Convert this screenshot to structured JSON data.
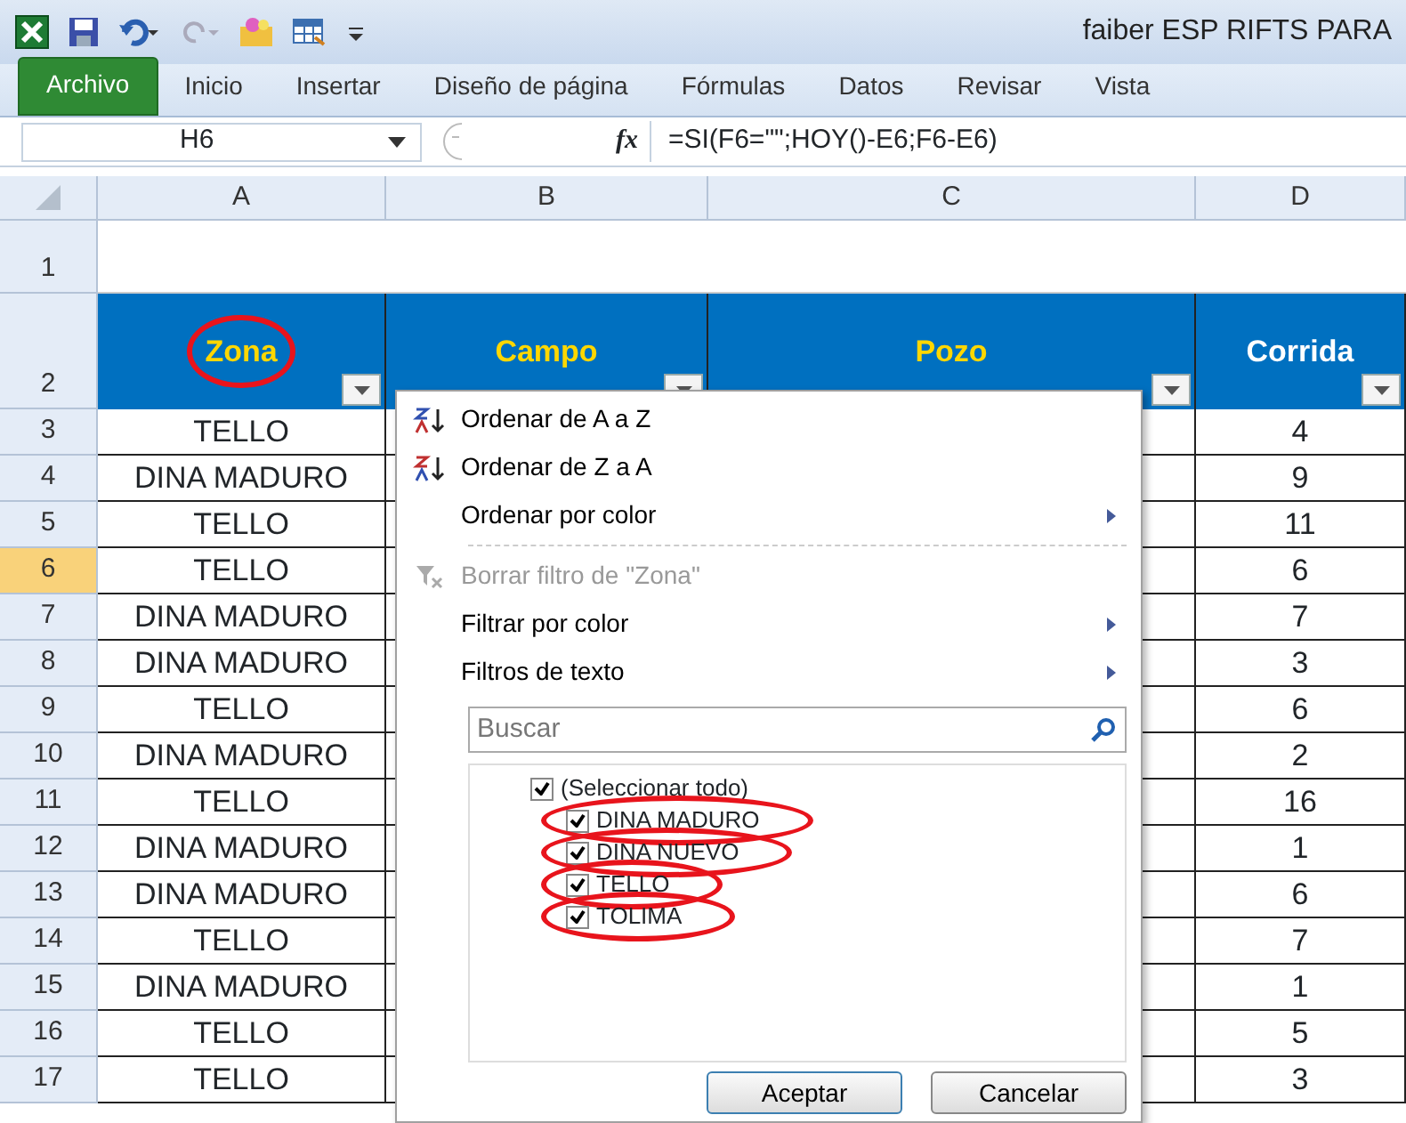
{
  "window": {
    "title": "faiber ESP RIFTS  PARA"
  },
  "ribbon_tabs": [
    {
      "label": "Archivo",
      "selected": true
    },
    {
      "label": "Inicio",
      "selected": false
    },
    {
      "label": "Insertar",
      "selected": false
    },
    {
      "label": "Diseño de página",
      "selected": false
    },
    {
      "label": "Fórmulas",
      "selected": false
    },
    {
      "label": "Datos",
      "selected": false
    },
    {
      "label": "Revisar",
      "selected": false
    },
    {
      "label": "Vista",
      "selected": false
    }
  ],
  "formula_bar": {
    "name_box": "H6",
    "function_button": "fx",
    "formula": "=SI(F6=\"\";HOY()-E6;F6-E6)"
  },
  "columns": [
    {
      "letter": "A",
      "header": "Zona",
      "color": "#ffd700",
      "circled": true
    },
    {
      "letter": "B",
      "header": "Campo",
      "color": "#ffd700",
      "circled": false
    },
    {
      "letter": "C",
      "header": "Pozo",
      "color": "#ffd700",
      "circled": false
    },
    {
      "letter": "D",
      "header": "Corrida",
      "color": "#ffffff",
      "circled": false
    }
  ],
  "header_row_numbers": [
    "1",
    "2"
  ],
  "rows": [
    {
      "number": "3",
      "zona": "TELLO",
      "corrida": "4",
      "selected": false
    },
    {
      "number": "4",
      "zona": "DINA MADURO",
      "corrida": "9",
      "selected": false
    },
    {
      "number": "5",
      "zona": "TELLO",
      "corrida": "11",
      "selected": false
    },
    {
      "number": "6",
      "zona": "TELLO",
      "corrida": "6",
      "selected": true
    },
    {
      "number": "7",
      "zona": "DINA MADURO",
      "corrida": "7",
      "selected": false
    },
    {
      "number": "8",
      "zona": "DINA MADURO",
      "corrida": "3",
      "selected": false
    },
    {
      "number": "9",
      "zona": "TELLO",
      "corrida": "6",
      "selected": false
    },
    {
      "number": "10",
      "zona": "DINA MADURO",
      "corrida": "2",
      "selected": false
    },
    {
      "number": "11",
      "zona": "TELLO",
      "corrida": "16",
      "selected": false
    },
    {
      "number": "12",
      "zona": "DINA MADURO",
      "corrida": "1",
      "selected": false
    },
    {
      "number": "13",
      "zona": "DINA MADURO",
      "corrida": "6",
      "selected": false
    },
    {
      "number": "14",
      "zona": "TELLO",
      "corrida": "7",
      "selected": false
    },
    {
      "number": "15",
      "zona": "DINA MADURO",
      "corrida": "1",
      "selected": false
    },
    {
      "number": "16",
      "zona": "TELLO",
      "corrida": "5",
      "selected": false
    },
    {
      "number": "17",
      "zona": "TELLO",
      "corrida": "3",
      "selected": false
    }
  ],
  "filter_menu": {
    "items": [
      {
        "kind": "sort-asc",
        "label": "Ordenar de A a Z",
        "disabled": false,
        "submenu": false
      },
      {
        "kind": "sort-desc",
        "label": "Ordenar de Z a A",
        "disabled": false,
        "submenu": false
      },
      {
        "kind": "plain",
        "label": "Ordenar por color",
        "disabled": false,
        "submenu": true
      },
      {
        "kind": "separator"
      },
      {
        "kind": "clear-filter",
        "label": "Borrar filtro de \"Zona\"",
        "disabled": true,
        "submenu": false
      },
      {
        "kind": "plain",
        "label": "Filtrar por color",
        "disabled": false,
        "submenu": true
      },
      {
        "kind": "plain",
        "label": "Filtros de texto",
        "disabled": false,
        "submenu": true
      }
    ],
    "search": {
      "placeholder": "Buscar"
    },
    "values": [
      {
        "label": "(Seleccionar todo)",
        "checked": true,
        "circled": false,
        "children": [
          {
            "label": "DINA MADURO",
            "checked": true,
            "circled": true
          },
          {
            "label": "DINA NUEVO",
            "checked": true,
            "circled": true
          },
          {
            "label": "TELLO",
            "checked": true,
            "circled": true
          },
          {
            "label": "TOLIMA",
            "checked": true,
            "circled": true
          }
        ]
      }
    ],
    "buttons": [
      "Aceptar",
      "Cancelar"
    ]
  }
}
